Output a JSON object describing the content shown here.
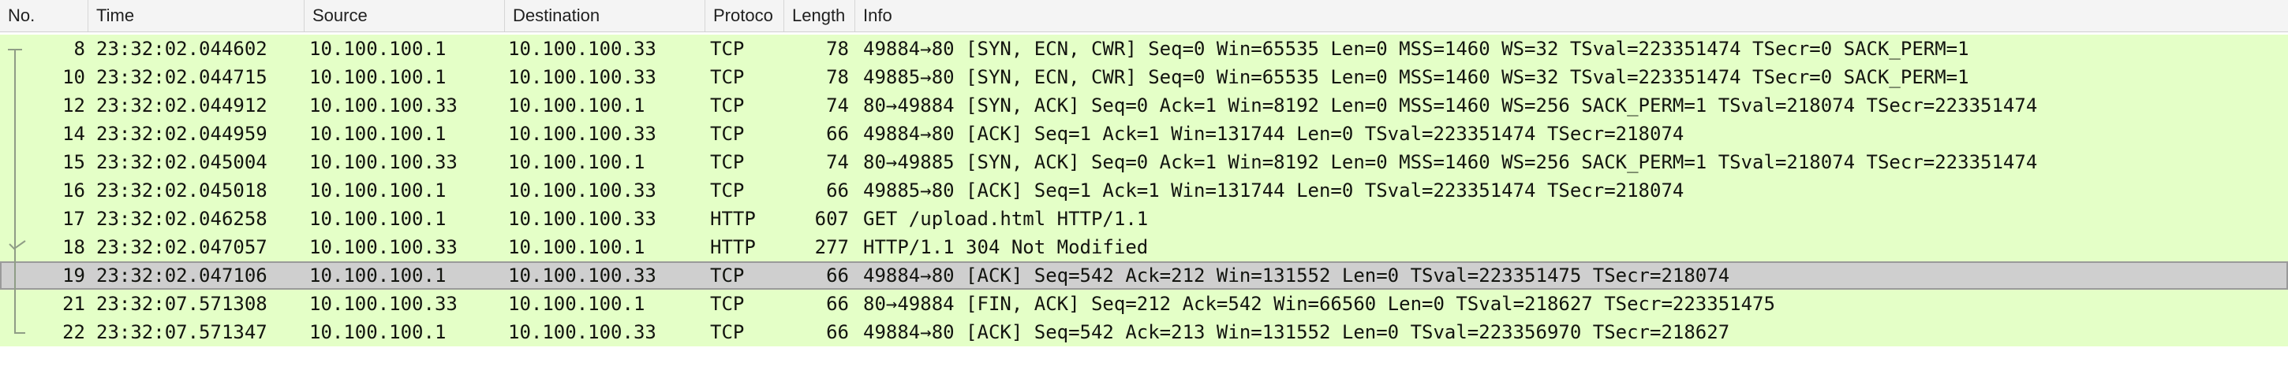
{
  "columns": [
    {
      "key": "no",
      "label": "No."
    },
    {
      "key": "time",
      "label": "Time"
    },
    {
      "key": "source",
      "label": "Source"
    },
    {
      "key": "destination",
      "label": "Destination"
    },
    {
      "key": "protocol",
      "label": "Protoco"
    },
    {
      "key": "length",
      "label": "Length"
    },
    {
      "key": "info",
      "label": "Info"
    }
  ],
  "colors": {
    "row_tcp_bg": "#e4ffc7",
    "row_selected_bg": "#cfcfcf",
    "header_bg": "#f4f4f4"
  },
  "icons": {
    "conversation": "conversation-bracket-icon",
    "ack_marker": "ack-check-icon"
  },
  "packets": [
    {
      "no": "8",
      "time": "23:32:02.044602",
      "source": "10.100.100.1",
      "destination": "10.100.100.33",
      "protocol": "TCP",
      "length": "78",
      "info": "49884→80 [SYN, ECN, CWR] Seq=0 Win=65535 Len=0 MSS=1460 WS=32 TSval=223351474 TSecr=0 SACK_PERM=1"
    },
    {
      "no": "10",
      "time": "23:32:02.044715",
      "source": "10.100.100.1",
      "destination": "10.100.100.33",
      "protocol": "TCP",
      "length": "78",
      "info": "49885→80 [SYN, ECN, CWR] Seq=0 Win=65535 Len=0 MSS=1460 WS=32 TSval=223351474 TSecr=0 SACK_PERM=1"
    },
    {
      "no": "12",
      "time": "23:32:02.044912",
      "source": "10.100.100.33",
      "destination": "10.100.100.1",
      "protocol": "TCP",
      "length": "74",
      "info": "80→49884 [SYN, ACK] Seq=0 Ack=1 Win=8192 Len=0 MSS=1460 WS=256 SACK_PERM=1 TSval=218074 TSecr=223351474"
    },
    {
      "no": "14",
      "time": "23:32:02.044959",
      "source": "10.100.100.1",
      "destination": "10.100.100.33",
      "protocol": "TCP",
      "length": "66",
      "info": "49884→80 [ACK] Seq=1 Ack=1 Win=131744 Len=0 TSval=223351474 TSecr=218074"
    },
    {
      "no": "15",
      "time": "23:32:02.045004",
      "source": "10.100.100.33",
      "destination": "10.100.100.1",
      "protocol": "TCP",
      "length": "74",
      "info": "80→49885 [SYN, ACK] Seq=0 Ack=1 Win=8192 Len=0 MSS=1460 WS=256 SACK_PERM=1 TSval=218074 TSecr=223351474"
    },
    {
      "no": "16",
      "time": "23:32:02.045018",
      "source": "10.100.100.1",
      "destination": "10.100.100.33",
      "protocol": "TCP",
      "length": "66",
      "info": "49885→80 [ACK] Seq=1 Ack=1 Win=131744 Len=0 TSval=223351474 TSecr=218074"
    },
    {
      "no": "17",
      "time": "23:32:02.046258",
      "source": "10.100.100.1",
      "destination": "10.100.100.33",
      "protocol": "HTTP",
      "length": "607",
      "info": "GET /upload.html HTTP/1.1"
    },
    {
      "no": "18",
      "time": "23:32:02.047057",
      "source": "10.100.100.33",
      "destination": "10.100.100.1",
      "protocol": "HTTP",
      "length": "277",
      "info": "HTTP/1.1 304 Not Modified"
    },
    {
      "no": "19",
      "time": "23:32:02.047106",
      "source": "10.100.100.1",
      "destination": "10.100.100.33",
      "protocol": "TCP",
      "length": "66",
      "info": "49884→80 [ACK] Seq=542 Ack=212 Win=131552 Len=0 TSval=223351475 TSecr=218074",
      "selected": true
    },
    {
      "no": "21",
      "time": "23:32:07.571308",
      "source": "10.100.100.33",
      "destination": "10.100.100.1",
      "protocol": "TCP",
      "length": "66",
      "info": "80→49884 [FIN, ACK] Seq=212 Ack=542 Win=66560 Len=0 TSval=218627 TSecr=223351475"
    },
    {
      "no": "22",
      "time": "23:32:07.571347",
      "source": "10.100.100.1",
      "destination": "10.100.100.33",
      "protocol": "TCP",
      "length": "66",
      "info": "49884→80 [ACK] Seq=542 Ack=213 Win=131552 Len=0 TSval=223356970 TSecr=218627"
    }
  ]
}
